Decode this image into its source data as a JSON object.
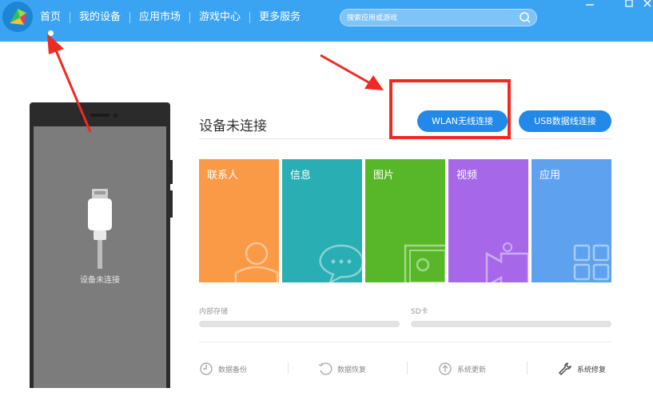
{
  "colors": {
    "topbar": "#3aa4f3",
    "accent_button": "#2289e8",
    "annotation_red": "#ee2a25",
    "tile_contacts": "#fb9a46",
    "tile_messages": "#28aeb3",
    "tile_photos": "#58b729",
    "tile_videos": "#a668e9",
    "tile_apps": "#5ea1ee"
  },
  "window": {
    "minimize_icon": "minimize-icon",
    "maximize_icon": "maximize-icon",
    "close_icon": "close-icon"
  },
  "nav": {
    "items": [
      "首页",
      "我的设备",
      "应用市场",
      "游戏中心",
      "更多服务"
    ],
    "active": "首页"
  },
  "search": {
    "placeholder": "搜索应用或游戏",
    "icon": "search-icon"
  },
  "phone": {
    "status": "设备未连接"
  },
  "main": {
    "title": "设备未连接",
    "wlan_button": "WLAN无线连接",
    "usb_button": "USB数据线连接",
    "tiles": [
      {
        "label": "联系人",
        "icon": "contact-icon"
      },
      {
        "label": "信息",
        "icon": "chat-icon"
      },
      {
        "label": "图片",
        "icon": "image-icon"
      },
      {
        "label": "视频",
        "icon": "video-icon"
      },
      {
        "label": "应用",
        "icon": "apps-icon"
      }
    ],
    "storage": {
      "internal": "内部存储",
      "sd": "SD卡"
    },
    "tools": [
      {
        "label": "数据备份",
        "icon": "backup-icon"
      },
      {
        "label": "数据恢复",
        "icon": "restore-icon"
      },
      {
        "label": "系统更新",
        "icon": "update-icon"
      },
      {
        "label": "系统修复",
        "icon": "wrench-icon"
      }
    ]
  }
}
